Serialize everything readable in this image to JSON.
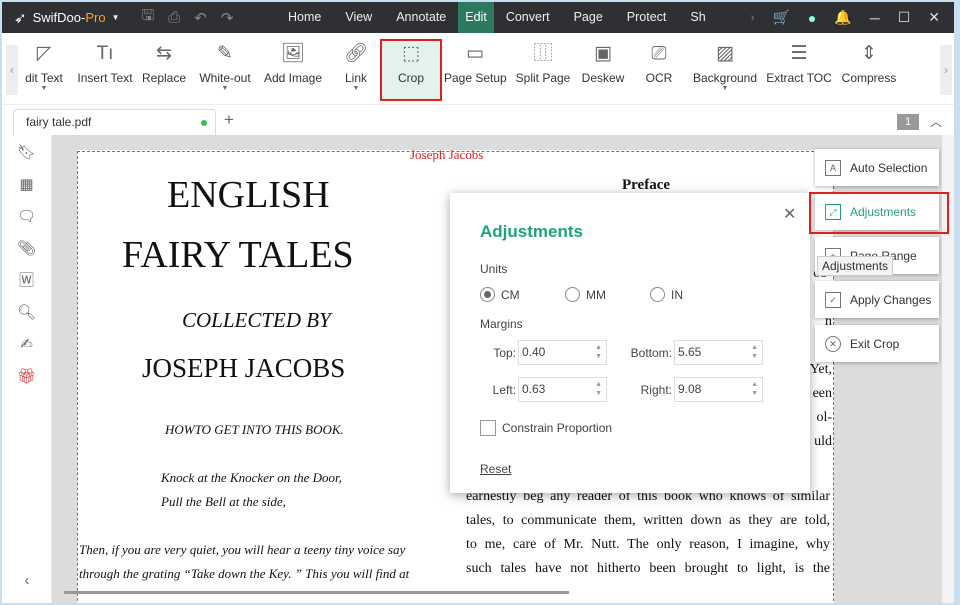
{
  "app": {
    "name": "SwifDoo-",
    "edition": "Pro"
  },
  "menu": [
    "Home",
    "View",
    "Annotate",
    "Edit",
    "Convert",
    "Page",
    "Protect",
    "Sh"
  ],
  "menu_active": "Edit",
  "toolbar": [
    {
      "label": "dit Text",
      "icon": "edit-text-icon",
      "dropdown": true
    },
    {
      "label": "Insert Text",
      "icon": "insert-text-icon"
    },
    {
      "label": "Replace",
      "icon": "replace-icon"
    },
    {
      "label": "White-out",
      "icon": "white-out-icon",
      "dropdown": true
    },
    {
      "label": "Add Image",
      "icon": "image-icon"
    },
    {
      "label": "Link",
      "icon": "link-icon",
      "dropdown": true
    },
    {
      "label": "Crop",
      "icon": "crop-icon"
    },
    {
      "label": "Page Setup",
      "icon": "page-setup-icon"
    },
    {
      "label": "Split Page",
      "icon": "split-page-icon"
    },
    {
      "label": "Deskew",
      "icon": "deskew-icon"
    },
    {
      "label": "OCR",
      "icon": "ocr-icon"
    },
    {
      "label": "Background",
      "icon": "background-icon",
      "dropdown": true
    },
    {
      "label": "Extract TOC",
      "icon": "extract-toc-icon"
    },
    {
      "label": "Compress",
      "icon": "compress-icon"
    }
  ],
  "tab": {
    "name": "fairy tale.pdf"
  },
  "page_number": "1",
  "page": {
    "header": "Joseph Jacobs",
    "title1": "ENGLISH",
    "title2": "FAIRY TALES",
    "collected": "COLLECTED BY",
    "author": "JOSEPH JACOBS",
    "howto": "HOWTO GET INTO THIS BOOK.",
    "verse1": "Knock at the Knocker on the Door,",
    "verse2": "Pull the Bell at the side,",
    "para1": "Then, if you are very quiet, you will hear a teeny tiny voice say",
    "para2": "through the grating “Take down the Key. ” This you will find at",
    "preface": "Preface",
    "right_fragments": [
      "n?",
      "r",
      "ob-",
      "t",
      "n",
      "of",
      "Yet,",
      "een",
      "ol-",
      "uld"
    ],
    "right_lines": [
      "earnestly beg any reader of this book who knows of similar",
      "tales, to communicate them, written down as they are told,",
      "to me, care of Mr. Nutt. The only reason, I imagine, why",
      "such tales have not hitherto been brought to light, is the"
    ]
  },
  "dialog": {
    "title": "Adjustments",
    "units_label": "Units",
    "units": [
      "CM",
      "MM",
      "IN"
    ],
    "selected_unit": "CM",
    "margins_label": "Margins",
    "top_label": "Top:",
    "top": "0.40",
    "bottom_label": "Bottom:",
    "bottom": "5.65",
    "left_label": "Left:",
    "left": "0.63",
    "right_label": "Right:",
    "right": "9.08",
    "constrain": "Constrain Proportion",
    "constrain_checked": false,
    "reset": "Reset"
  },
  "crop_panel": [
    "Auto Selection",
    "Adjustments",
    "Page Range",
    "Apply Changes",
    "Exit Crop"
  ],
  "tooltip": "Adjustments",
  "colors": {
    "accent": "#1fa37a",
    "highlight": "#e02020",
    "titlebar": "#2e3033"
  }
}
